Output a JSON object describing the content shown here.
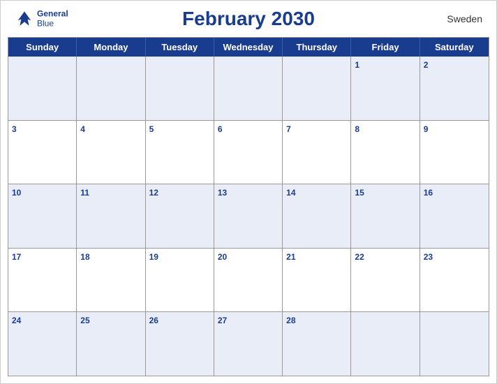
{
  "header": {
    "title": "February 2030",
    "country": "Sweden",
    "logo": {
      "line1": "General",
      "line2": "Blue"
    }
  },
  "days": [
    "Sunday",
    "Monday",
    "Tuesday",
    "Wednesday",
    "Thursday",
    "Friday",
    "Saturday"
  ],
  "weeks": [
    [
      {
        "date": "",
        "empty": true
      },
      {
        "date": "",
        "empty": true
      },
      {
        "date": "",
        "empty": true
      },
      {
        "date": "",
        "empty": true
      },
      {
        "date": "",
        "empty": true
      },
      {
        "date": "1",
        "empty": false
      },
      {
        "date": "2",
        "empty": false
      }
    ],
    [
      {
        "date": "3",
        "empty": false
      },
      {
        "date": "4",
        "empty": false
      },
      {
        "date": "5",
        "empty": false
      },
      {
        "date": "6",
        "empty": false
      },
      {
        "date": "7",
        "empty": false
      },
      {
        "date": "8",
        "empty": false
      },
      {
        "date": "9",
        "empty": false
      }
    ],
    [
      {
        "date": "10",
        "empty": false
      },
      {
        "date": "11",
        "empty": false
      },
      {
        "date": "12",
        "empty": false
      },
      {
        "date": "13",
        "empty": false
      },
      {
        "date": "14",
        "empty": false
      },
      {
        "date": "15",
        "empty": false
      },
      {
        "date": "16",
        "empty": false
      }
    ],
    [
      {
        "date": "17",
        "empty": false
      },
      {
        "date": "18",
        "empty": false
      },
      {
        "date": "19",
        "empty": false
      },
      {
        "date": "20",
        "empty": false
      },
      {
        "date": "21",
        "empty": false
      },
      {
        "date": "22",
        "empty": false
      },
      {
        "date": "23",
        "empty": false
      }
    ],
    [
      {
        "date": "24",
        "empty": false
      },
      {
        "date": "25",
        "empty": false
      },
      {
        "date": "26",
        "empty": false
      },
      {
        "date": "27",
        "empty": false
      },
      {
        "date": "28",
        "empty": false
      },
      {
        "date": "",
        "empty": true
      },
      {
        "date": "",
        "empty": true
      }
    ]
  ],
  "rowShading": [
    "shaded",
    "white",
    "shaded",
    "white",
    "shaded"
  ]
}
